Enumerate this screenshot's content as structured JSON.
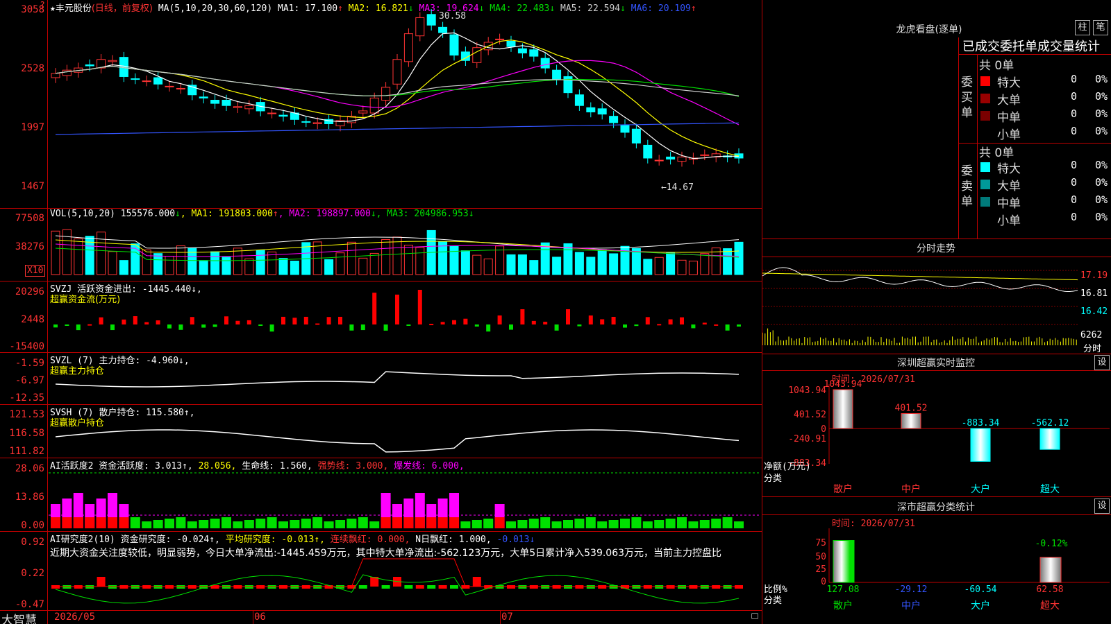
{
  "stock": {
    "star": "★",
    "name": "丰元股份",
    "mode": "(日线，前复权)",
    "ma_label": "MA(5,10,20,30,60,120)",
    "ma": [
      {
        "label": "MA1:",
        "value": "17.100",
        "arrow": "↑",
        "color": "#ffffff"
      },
      {
        "label": "MA2:",
        "value": "16.821",
        "arrow": "↓",
        "color": "#ffff00"
      },
      {
        "label": "MA3:",
        "value": "19.624",
        "arrow": "↓",
        "color": "#ff00ff"
      },
      {
        "label": "MA4:",
        "value": "22.483",
        "arrow": "↓",
        "color": "#00e000"
      },
      {
        "label": "MA5:",
        "value": "22.594",
        "arrow": "↓",
        "color": "#cccccc"
      },
      {
        "label": "MA6:",
        "value": "20.109",
        "arrow": "↑",
        "color": "#3355ff"
      }
    ],
    "price_axis": [
      "3058",
      "2528",
      "1997",
      "1467"
    ],
    "high_mark": "30.58",
    "low_mark": "←14.67"
  },
  "volume": {
    "legend_label": "VOL(5,10,20)",
    "legend_value": "155576.000",
    "legend_arrow": "↓",
    "ma": [
      {
        "label": "MA1:",
        "value": "191803.000",
        "arrow": "↑",
        "color": "#ffff00"
      },
      {
        "label": "MA2:",
        "value": "198897.000",
        "arrow": "↓",
        "color": "#ff00ff"
      },
      {
        "label": "MA3:",
        "value": "204986.953",
        "arrow": "↓",
        "color": "#00e000"
      }
    ],
    "axis": [
      "77508",
      "38276"
    ],
    "unit": "X10"
  },
  "svzj": {
    "legend": "SVZJ  活跃资金进出: -1445.440↓,",
    "subtitle": "超赢资金流(万元)",
    "axis": [
      "20296",
      "2448",
      "-15400"
    ]
  },
  "svzl": {
    "legend": "SVZL (7) 主力持仓: -4.960↓,",
    "subtitle": "超赢主力持仓",
    "axis": [
      "-1.59",
      "-6.97",
      "-12.35"
    ]
  },
  "svsh": {
    "legend": "SVSH (7) 散户持仓: 115.580↑,",
    "subtitle": "超赢散户持仓",
    "axis": [
      "121.53",
      "116.58",
      "111.82"
    ]
  },
  "ai1": {
    "legend_a": "AI活跃度2 资金活跃度: 3.013↑,",
    "legend_b": " 28.056,",
    "legend_c": " 生命线: 1.560,",
    "legend_d": " 强势线: 3.000,",
    "legend_e": " 爆发线: 6.000,",
    "axis": [
      "28.06",
      "13.86",
      "0.00"
    ]
  },
  "ai2": {
    "legend_a": "AI研究度2(10) 资金研究度: -0.024↑,",
    "legend_b": " 平均研究度: -0.013↑,",
    "legend_c": " 连续飘红: 0.000,",
    "legend_d": " N日飘红: 1.000,",
    "legend_e": " -0.013↓",
    "comment": "近期大资金关注度较低，明显弱势，今日大单净流出:-1445.459万元，其中特大单净流出:-562.123万元，大单5日累计净入539.063万元，当前主力控盘比",
    "axis": [
      "0.92",
      "0.22",
      "-0.47"
    ]
  },
  "bottom": {
    "logo": "大智慧",
    "dates": [
      "2026/05",
      "06",
      "07"
    ]
  },
  "dragon": {
    "title": "龙虎看盘(逐单)",
    "btn_a": "柱",
    "btn_b": "笔",
    "tabs": "已成交委托单成交量统计",
    "buy": {
      "side": "委买单",
      "total": "共 0单",
      "rows": [
        {
          "label": "特大",
          "count": "0",
          "pct": "0%",
          "color": "#ff0000"
        },
        {
          "label": "大单",
          "count": "0",
          "pct": "0%",
          "color": "#990000"
        },
        {
          "label": "中单",
          "count": "0",
          "pct": "0%",
          "color": "#7a0000"
        },
        {
          "label": "小单",
          "count": "0",
          "pct": "0%",
          "color": "#000000"
        }
      ]
    },
    "sell": {
      "side": "委卖单",
      "total": "共 0单",
      "rows": [
        {
          "label": "特大",
          "count": "0",
          "pct": "0%",
          "color": "#00ffff"
        },
        {
          "label": "大单",
          "count": "0",
          "pct": "0%",
          "color": "#009999"
        },
        {
          "label": "中单",
          "count": "0",
          "pct": "0%",
          "color": "#007a7a"
        },
        {
          "label": "小单",
          "count": "0",
          "pct": "0%",
          "color": "#000000"
        }
      ]
    }
  },
  "intraday": {
    "title": "分时走势",
    "axis": [
      "17.19",
      "16.81",
      "16.42",
      "6262"
    ],
    "axis_label": "分时"
  },
  "monitor": {
    "title": "深圳超赢实时监控",
    "btn": "设",
    "time": "时间: 2026/07/31",
    "axis": [
      "1043.94",
      "401.52",
      "0",
      "-240.91",
      "-883.34"
    ],
    "ylabel": "净额(万元)",
    "xlabel": "分类",
    "bars": [
      {
        "cat": "散户",
        "value": "1043.94"
      },
      {
        "cat": "中户",
        "value": "401.52"
      },
      {
        "cat": "大户",
        "value": "-883.34"
      },
      {
        "cat": "超大",
        "value": "-562.12"
      }
    ]
  },
  "stats": {
    "title": "深市超赢分类统计",
    "btn": "设",
    "time": "时间: 2026/07/31",
    "axis": [
      "75",
      "50",
      "25",
      "0"
    ],
    "ylabel": "比例%",
    "xlabel": "分类",
    "top_label": "-0.12%",
    "bars": [
      {
        "cat": "散户",
        "value": "127.08"
      },
      {
        "cat": "中户",
        "value": "-29.12"
      },
      {
        "cat": "大户",
        "value": "-60.54"
      },
      {
        "cat": "超大",
        "value": "62.58"
      }
    ]
  }
}
